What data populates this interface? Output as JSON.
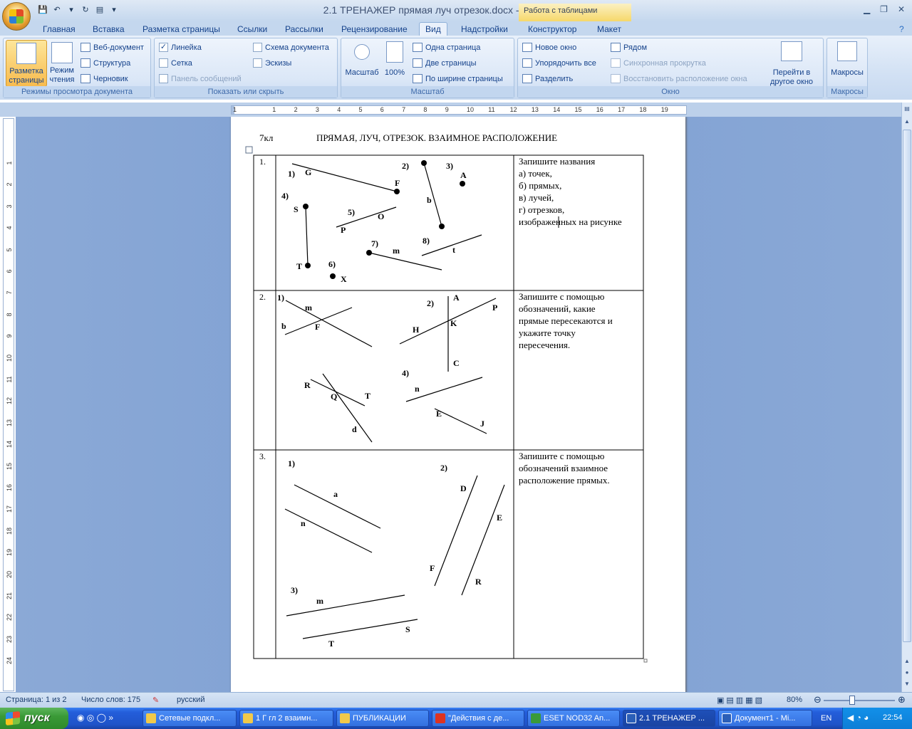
{
  "window": {
    "title": "2.1 ТРЕНАЖЕР прямая луч отрезок.docx - Microsoft Word",
    "context_tab": "Работа с таблицами"
  },
  "tabs": [
    "Главная",
    "Вставка",
    "Разметка страницы",
    "Ссылки",
    "Рассылки",
    "Рецензирование",
    "Вид",
    "Надстройки",
    "Конструктор",
    "Макет"
  ],
  "ribbon": {
    "views": {
      "title": "Режимы просмотра документа",
      "print_layout": "Разметка страницы",
      "reading": "Режим чтения",
      "web": "Веб-документ",
      "outline": "Структура",
      "draft": "Черновик"
    },
    "show": {
      "title": "Показать или скрыть",
      "ruler": "Линейка",
      "grid": "Сетка",
      "message_bar": "Панель сообщений",
      "doc_map": "Схема документа",
      "thumbnails": "Эскизы"
    },
    "zoom": {
      "title": "Масштаб",
      "zoom": "Масштаб",
      "hundred": "100%",
      "one_page": "Одна страница",
      "two_pages": "Две страницы",
      "page_width": "По ширине страницы"
    },
    "window": {
      "title": "Окно",
      "new_window": "Новое окно",
      "arrange_all": "Упорядочить все",
      "split": "Разделить",
      "side_by_side": "Рядом",
      "sync_scroll": "Синхронная прокрутка",
      "reset_pos": "Восстановить расположение окна",
      "switch": "Перейти в другое окно"
    },
    "macros": {
      "title": "Макросы",
      "macros": "Макросы"
    }
  },
  "ruler_numbers": [
    "1",
    "1",
    "2",
    "3",
    "4",
    "5",
    "6",
    "7",
    "8",
    "9",
    "10",
    "11",
    "12",
    "13",
    "14",
    "15",
    "16",
    "17",
    "18",
    "19"
  ],
  "vruler_numbers": [
    "1",
    "2",
    "3",
    "4",
    "5",
    "6",
    "7",
    "8",
    "9",
    "10",
    "11",
    "12",
    "13",
    "14",
    "15",
    "16",
    "17",
    "18",
    "19",
    "20",
    "21",
    "22",
    "23",
    "24"
  ],
  "doc": {
    "header_left": "7кл",
    "header_title": "ПРЯМАЯ, ЛУЧ, ОТРЕЗОК. ВЗАИМНОЕ РАСПОЛОЖЕНИЕ",
    "rows": [
      {
        "num": "1.",
        "task": [
          "Запишите названия",
          "а) точек,",
          "б) прямых,",
          "в) лучей,",
          "г) отрезков,",
          "изображенных на рисунке"
        ]
      },
      {
        "num": "2.",
        "task": [
          "Запишите с помощью",
          "обозначений, какие",
          "прямые пересекаются и",
          "укажите точку",
          "пересечения."
        ]
      },
      {
        "num": "3.",
        "task": [
          "Запишите с помощью",
          "обозначений  взаимное",
          "расположение прямых."
        ]
      }
    ],
    "fig1": [
      "1)",
      "G",
      "F",
      "2)",
      "3)",
      "A",
      "4)",
      "S",
      "b",
      "5)",
      "O",
      "P",
      "8)",
      "7)",
      "m",
      "t",
      "6)",
      "T",
      "X"
    ],
    "fig2": [
      "1)",
      "m",
      "b",
      "F",
      "2)",
      "A",
      "P",
      "H",
      "K",
      "C",
      "R",
      "Q",
      "T",
      "d",
      "4)",
      "n",
      "E",
      "J"
    ],
    "fig3": [
      "1)",
      "a",
      "n",
      "2)",
      "D",
      "E",
      "F",
      "R",
      "3)",
      "m",
      "S",
      "T"
    ]
  },
  "status": {
    "page": "Страница: 1 из 2",
    "words": "Число слов: 175",
    "lang": "русский",
    "zoom": "80%"
  },
  "taskbar": {
    "start": "пуск",
    "items": [
      "Сетевые подкл...",
      "1 Г гл 2 взаимн...",
      "ПУБЛИКАЦИИ",
      "\"Действия с де...",
      "ESET NOD32 An...",
      "2.1 ТРЕНАЖЕР ...",
      "Документ1 - Mi..."
    ],
    "lang": "EN",
    "time": "22:54"
  }
}
